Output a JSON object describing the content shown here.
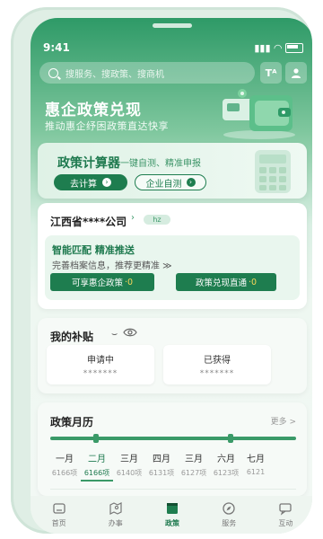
{
  "status": {
    "time": "9:41"
  },
  "search": {
    "placeholder": "搜服务、搜政策、搜商机"
  },
  "header": {
    "text_size_icon": "Tᴬ"
  },
  "hero": {
    "title": "惠企政策兑现",
    "subtitle": "推动惠企纾困政策直达快享"
  },
  "calculator": {
    "title": "政策计算器",
    "subtitle": "一键自测、精准申报",
    "primary_button": "去计算",
    "secondary_button": "企业自测"
  },
  "company": {
    "name": "江西省****公司",
    "tag": "hz",
    "match_title": "智能匹配  精准推送",
    "match_subtitle": "完善档案信息，推荐更精准 ≫",
    "btn_policy_label": "可享惠企政策",
    "btn_policy_value": "·0",
    "btn_direct_label": "政策兑现直通",
    "btn_direct_value": "·0"
  },
  "subsidy": {
    "title": "我的补贴",
    "applying_label": "申请中",
    "applying_value": "*******",
    "obtained_label": "已获得",
    "obtained_value": "*******"
  },
  "calendar": {
    "title": "政策月历",
    "more": "更多 >",
    "months": [
      {
        "month": "一月",
        "count": "6166项"
      },
      {
        "month": "二月",
        "count": "6166项"
      },
      {
        "month": "三月",
        "count": "6140项"
      },
      {
        "month": "四月",
        "count": "6131项"
      },
      {
        "month": "三月",
        "count": "6127项"
      },
      {
        "month": "六月",
        "count": "6123项"
      },
      {
        "month": "七月",
        "count": "6121"
      }
    ]
  },
  "tabs": [
    {
      "label": "首页",
      "icon": "home-icon"
    },
    {
      "label": "办事",
      "icon": "map-icon"
    },
    {
      "label": "政策",
      "icon": "policy-icon"
    },
    {
      "label": "服务",
      "icon": "compass-icon"
    },
    {
      "label": "互动",
      "icon": "chat-icon"
    }
  ],
  "colors": {
    "primary": "#1e7d4f",
    "accent_value": "#f7d65a",
    "hero_top": "#2e9a67"
  }
}
